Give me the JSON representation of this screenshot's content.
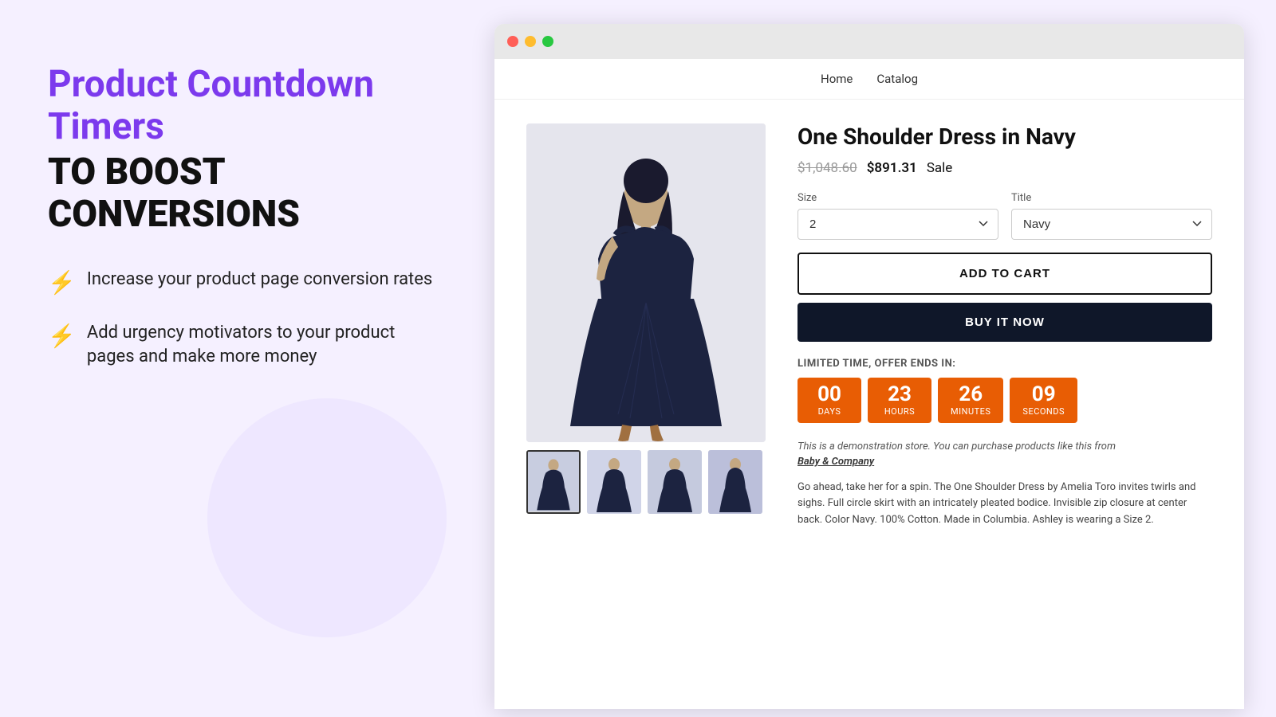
{
  "left": {
    "headline_purple": "Product Countdown Timers",
    "headline_black": "TO BOOST CONVERSIONS",
    "features": [
      {
        "icon": "⚡",
        "text": "Increase your product page conversion rates"
      },
      {
        "icon": "⚡",
        "text": "Add urgency motivators to your product pages and make more money"
      }
    ]
  },
  "browser": {
    "nav": {
      "links": [
        "Home",
        "Catalog"
      ]
    },
    "product": {
      "title": "One Shoulder Dress in Navy",
      "price_original": "$1,048.60",
      "price_sale": "$891.31",
      "price_sale_label": "Sale",
      "size_label": "Size",
      "size_value": "2",
      "title_label": "Title",
      "title_value": "Navy",
      "btn_add_to_cart": "ADD TO CART",
      "btn_buy_now": "BUY IT NOW",
      "countdown_label": "LIMITED TIME, OFFER ENDS IN:",
      "countdown": [
        {
          "value": "00",
          "unit": "Days"
        },
        {
          "value": "23",
          "unit": "Hours"
        },
        {
          "value": "26",
          "unit": "Minutes"
        },
        {
          "value": "09",
          "unit": "Seconds"
        }
      ],
      "demo_note": "This is a demonstration store. You can purchase products like this from",
      "demo_link": "Baby & Company",
      "description": "Go ahead, take her for a spin. The One Shoulder Dress by Amelia Toro invites twirls and sighs. Full circle skirt with an intricately pleated bodice. Invisible zip closure at center back. Color Navy. 100% Cotton. Made in Columbia. Ashley is wearing a Size 2."
    }
  }
}
